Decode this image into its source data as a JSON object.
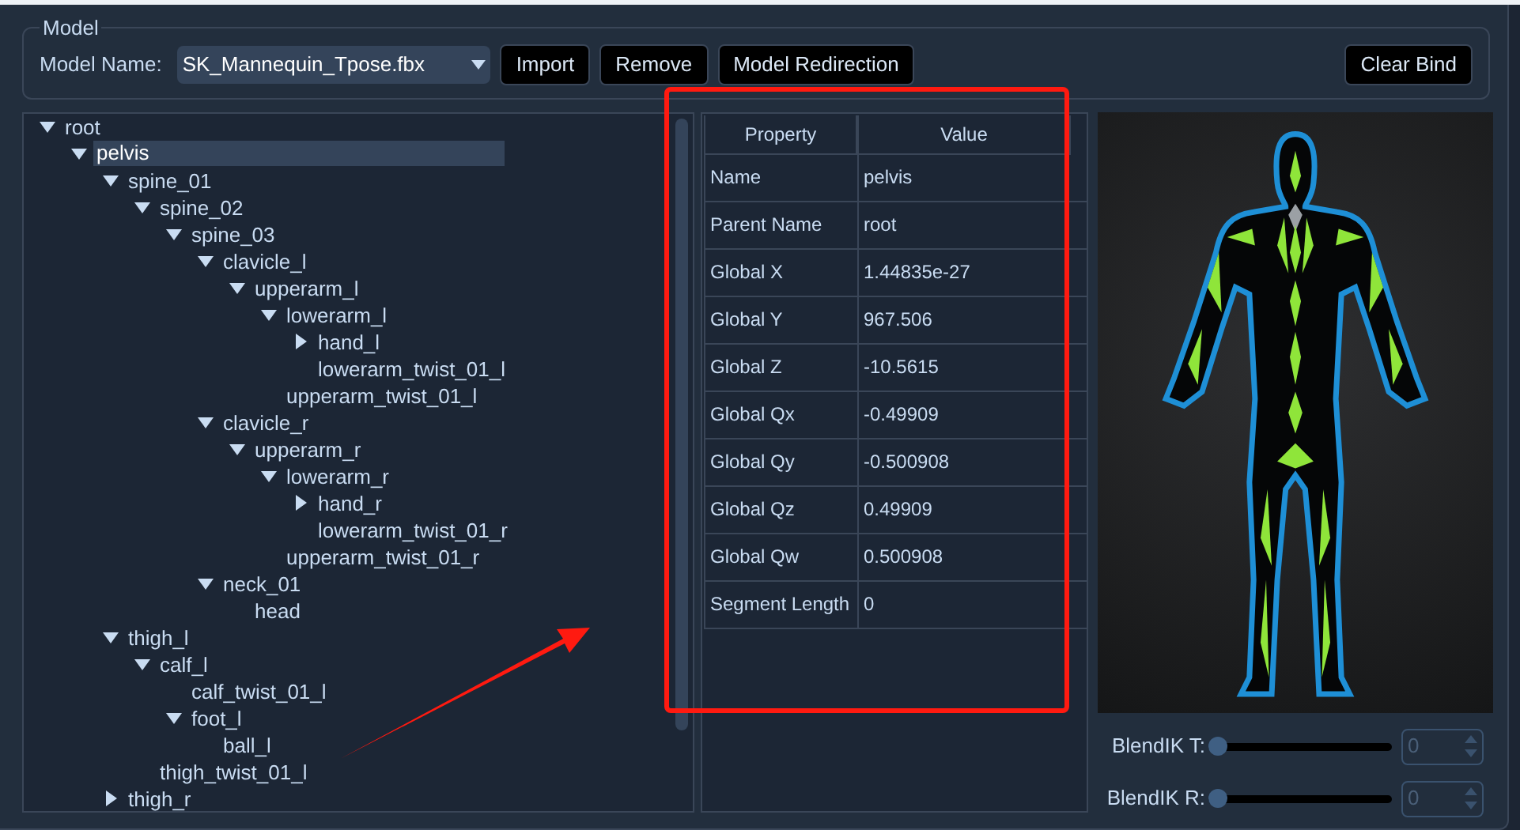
{
  "model": {
    "group_title": "Model",
    "name_label": "Model Name:",
    "selected_model": "SK_Mannequin_Tpose.fbx",
    "buttons": [
      "Import",
      "Remove",
      "Model Redirection"
    ],
    "clear_button": "Clear Bind"
  },
  "tree": [
    {
      "label": "root",
      "expanded": true,
      "selected": false,
      "children": [
        {
          "label": "pelvis",
          "expanded": true,
          "selected": true,
          "children": [
            {
              "label": "spine_01",
              "expanded": true,
              "selected": false,
              "children": [
                {
                  "label": "spine_02",
                  "expanded": true,
                  "selected": false,
                  "children": [
                    {
                      "label": "spine_03",
                      "expanded": true,
                      "selected": false,
                      "children": [
                        {
                          "label": "clavicle_l",
                          "expanded": true,
                          "selected": false,
                          "children": [
                            {
                              "label": "upperarm_l",
                              "expanded": true,
                              "selected": false,
                              "children": [
                                {
                                  "label": "lowerarm_l",
                                  "expanded": true,
                                  "selected": false,
                                  "children": [
                                    {
                                      "label": "hand_l",
                                      "expanded": false,
                                      "selected": false
                                    },
                                    {
                                      "label": "lowerarm_twist_01_l",
                                      "selected": false
                                    }
                                  ]
                                },
                                {
                                  "label": "upperarm_twist_01_l",
                                  "selected": false
                                }
                              ]
                            }
                          ]
                        },
                        {
                          "label": "clavicle_r",
                          "expanded": true,
                          "selected": false,
                          "children": [
                            {
                              "label": "upperarm_r",
                              "expanded": true,
                              "selected": false,
                              "children": [
                                {
                                  "label": "lowerarm_r",
                                  "expanded": true,
                                  "selected": false,
                                  "children": [
                                    {
                                      "label": "hand_r",
                                      "expanded": false,
                                      "selected": false
                                    },
                                    {
                                      "label": "lowerarm_twist_01_r",
                                      "selected": false
                                    }
                                  ]
                                },
                                {
                                  "label": "upperarm_twist_01_r",
                                  "selected": false
                                }
                              ]
                            }
                          ]
                        },
                        {
                          "label": "neck_01",
                          "expanded": true,
                          "selected": false,
                          "children": [
                            {
                              "label": "head",
                              "selected": false
                            }
                          ]
                        }
                      ]
                    }
                  ]
                }
              ]
            },
            {
              "label": "thigh_l",
              "expanded": true,
              "selected": false,
              "children": [
                {
                  "label": "calf_l",
                  "expanded": true,
                  "selected": false,
                  "children": [
                    {
                      "label": "calf_twist_01_l",
                      "selected": false
                    },
                    {
                      "label": "foot_l",
                      "expanded": true,
                      "selected": false,
                      "children": [
                        {
                          "label": "ball_l",
                          "selected": false
                        }
                      ]
                    }
                  ]
                },
                {
                  "label": "thigh_twist_01_l",
                  "selected": false
                }
              ]
            },
            {
              "label": "thigh_r",
              "expanded": false,
              "selected": false
            }
          ]
        }
      ]
    }
  ],
  "properties": {
    "columns": [
      "Property",
      "Value"
    ],
    "rows": [
      [
        "Name",
        "pelvis"
      ],
      [
        "Parent Name",
        "root"
      ],
      [
        "Global X",
        "1.44835e-27"
      ],
      [
        "Global Y",
        "967.506"
      ],
      [
        "Global Z",
        "-10.5615"
      ],
      [
        "Global Qx",
        "-0.49909"
      ],
      [
        "Global Qy",
        "-0.500908"
      ],
      [
        "Global Qz",
        "0.49909"
      ],
      [
        "Global Qw",
        "0.500908"
      ],
      [
        "Segment Length",
        "0"
      ]
    ]
  },
  "blend": [
    {
      "label": "BlendIK T:",
      "level": 0,
      "value": "0"
    },
    {
      "label": "BlendIK R:",
      "level": 0,
      "value": "0"
    }
  ]
}
